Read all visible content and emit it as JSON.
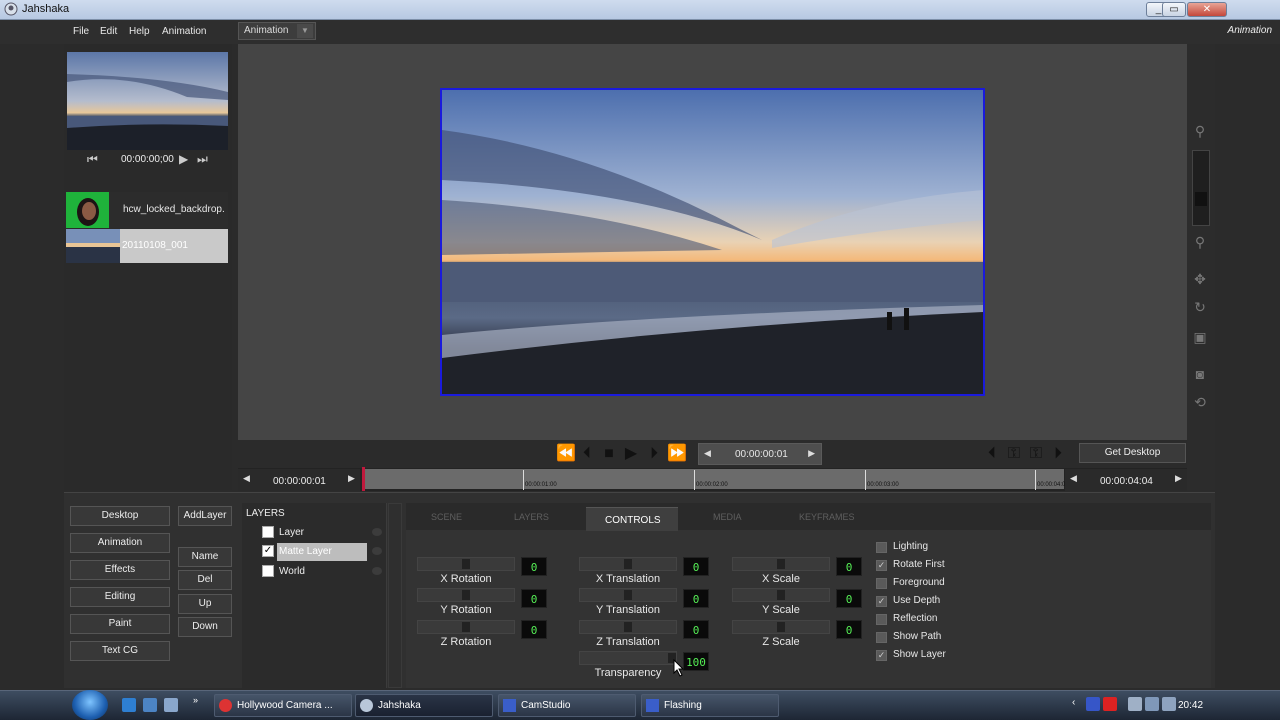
{
  "window": {
    "title": "Jahshaka"
  },
  "menu": {
    "items": [
      "File",
      "Edit",
      "Help",
      "Animation"
    ],
    "module_tab": "Animation",
    "mode_label": "Animation"
  },
  "preview": {
    "timecode": "00:00:00;00"
  },
  "clips": [
    {
      "name": "hcw_locked_backdrop."
    },
    {
      "name": "20110108_001"
    }
  ],
  "transport": {
    "timecode": "00:00:00:01",
    "get_desktop": "Get Desktop"
  },
  "timeline": {
    "start_tc": "00:00:00:01",
    "end_tc": "00:00:04:04",
    "ticks": [
      "00:00:01:00",
      "00:00:02:00",
      "00:00:03:00",
      "00:00:04:0"
    ]
  },
  "left_buttons": [
    "Desktop",
    "Animation",
    "Effects",
    "Editing",
    "Paint",
    "Text CG"
  ],
  "layer_buttons": [
    "AddLayer",
    "Name",
    "Del",
    "Up",
    "Down"
  ],
  "layers": {
    "title": "LAYERS",
    "items": [
      {
        "name": "Layer",
        "checked": false,
        "selected": false
      },
      {
        "name": "Matte Layer",
        "checked": true,
        "selected": true
      },
      {
        "name": "World",
        "checked": false,
        "selected": false
      }
    ]
  },
  "tabs": [
    "SCENE",
    "LAYERS",
    "CONTROLS",
    "MEDIA",
    "KEYFRAMES"
  ],
  "active_tab": "CONTROLS",
  "controls": {
    "x_rotation": {
      "label": "X Rotation",
      "value": "0"
    },
    "y_rotation": {
      "label": "Y Rotation",
      "value": "0"
    },
    "z_rotation": {
      "label": "Z Rotation",
      "value": "0"
    },
    "x_translation": {
      "label": "X Translation",
      "value": "0"
    },
    "y_translation": {
      "label": "Y Translation",
      "value": "0"
    },
    "z_translation": {
      "label": "Z Translation",
      "value": "0"
    },
    "transparency": {
      "label": "Transparency",
      "value": "100"
    },
    "x_scale": {
      "label": "X Scale",
      "value": "0"
    },
    "y_scale": {
      "label": "Y Scale",
      "value": "0"
    },
    "z_scale": {
      "label": "Z Scale",
      "value": "0"
    }
  },
  "options": [
    {
      "label": "Lighting",
      "checked": false
    },
    {
      "label": "Rotate First",
      "checked": true
    },
    {
      "label": "Foreground",
      "checked": false
    },
    {
      "label": "Use Depth",
      "checked": true
    },
    {
      "label": "Reflection",
      "checked": false
    },
    {
      "label": "Show Path",
      "checked": false
    },
    {
      "label": "Show Layer",
      "checked": true
    }
  ],
  "taskbar": {
    "tasks": [
      "Hollywood Camera ...",
      "Jahshaka",
      "CamStudio",
      "Flashing"
    ],
    "clock": "20:42"
  },
  "colors": {
    "viewer_border": "#1a1adc",
    "playhead": "#c0183c",
    "lcd_text": "#55ee55"
  }
}
